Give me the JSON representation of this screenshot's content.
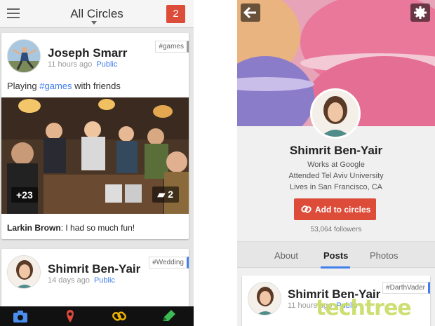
{
  "left": {
    "header": {
      "title": "All Circles",
      "notifications": "2"
    },
    "post1": {
      "author": "Joseph Smarr",
      "time": "11 hours ago",
      "visibility": "Public",
      "tag": "#games",
      "text_before": "Playing ",
      "hashtag": "#games",
      "text_after": " with friends",
      "plus_count": "+23",
      "comment_count": "2",
      "comment_author": "Larkin Brown",
      "comment_text": ": I had so much fun!"
    },
    "post2": {
      "author": "Shimrit Ben-Yair",
      "time": "14 days ago",
      "visibility": "Public",
      "tag": "#Wedding"
    },
    "bottom_nav": [
      "camera-icon",
      "location-pin-icon",
      "link-icon",
      "pencil-icon"
    ]
  },
  "right": {
    "profile": {
      "name": "Shimrit Ben-Yair",
      "work": "Works at Google",
      "education": "Attended Tel Aviv University",
      "location": "Lives in San Francisco, CA",
      "add_button": "Add to circles",
      "followers": "53,064 followers"
    },
    "tabs": [
      "About",
      "Posts",
      "Photos"
    ],
    "active_tab": "Posts",
    "post": {
      "author": "Shimrit Ben-Yair",
      "time": "11 hours ago",
      "visibility": "Public",
      "tag": "#DarthVader"
    },
    "watermark": "techtree"
  },
  "colors": {
    "accent_red": "#dd4b39",
    "link_blue": "#427fed"
  }
}
